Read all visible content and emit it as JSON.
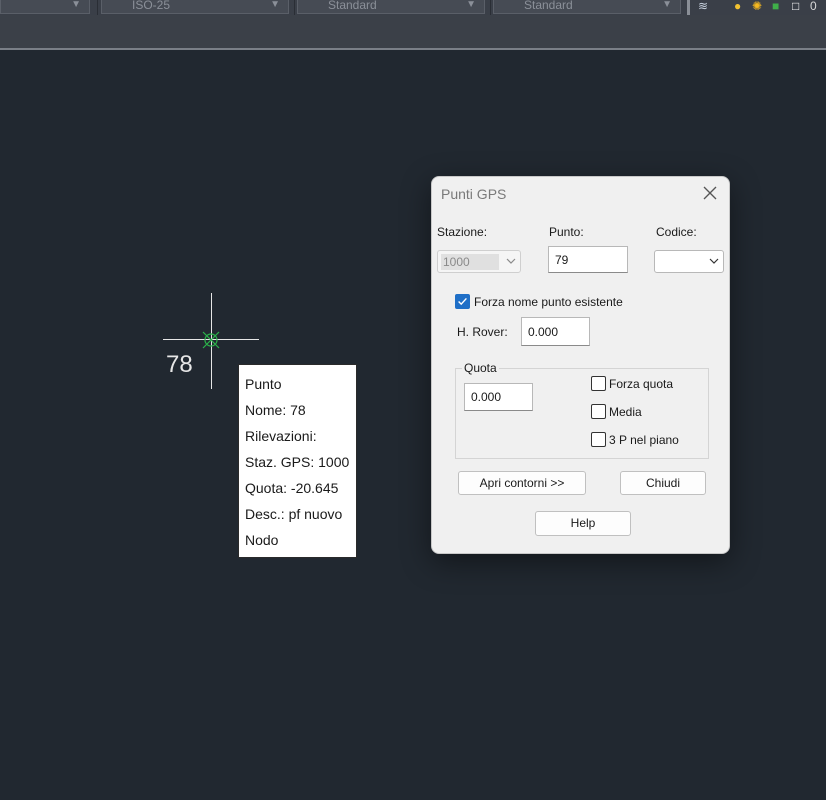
{
  "toolbar": {
    "dim_style": "ISO-25",
    "table_style": "Standard",
    "multileader_style": "Standard",
    "layer_value": "0"
  },
  "drawing": {
    "point_label": "78"
  },
  "tooltip": {
    "lines": [
      "Punto",
      "Nome: 78",
      "Rilevazioni:",
      "Staz. GPS: 1000",
      "Quota: -20.645",
      "Desc.: pf nuovo",
      "Nodo"
    ]
  },
  "dialog": {
    "title": "Punti GPS",
    "stazione_label": "Stazione:",
    "stazione_value": "1000",
    "punto_label": "Punto:",
    "punto_value": "79",
    "codice_label": "Codice:",
    "codice_value": "",
    "forza_nome_label": "Forza nome punto esistente",
    "forza_nome_checked": true,
    "h_rover_label": "H. Rover:",
    "h_rover_value": "0.000",
    "quota_group_label": "Quota",
    "quota_value": "0.000",
    "forza_quota_label": "Forza quota",
    "media_label": "Media",
    "tre_p_label": "3 P nel piano",
    "apri_contorni_label": "Apri contorni >>",
    "chiudi_label": "Chiudi",
    "help_label": "Help"
  },
  "colors": {
    "canvas_bg": "#212830",
    "accent": "#1f6fc7"
  }
}
